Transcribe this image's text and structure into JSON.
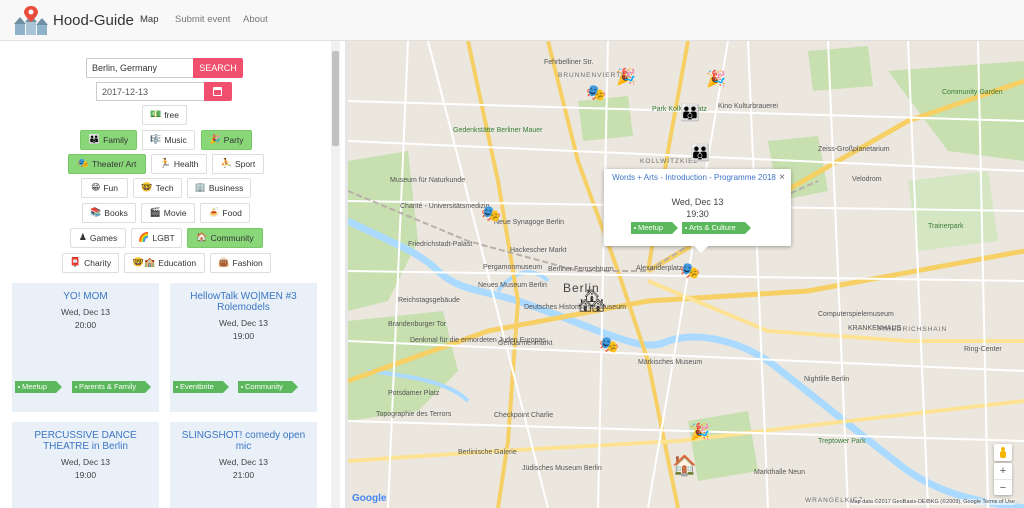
{
  "brand": {
    "title": "Hood-Guide"
  },
  "nav": {
    "map": "Map",
    "submit": "Submit event",
    "about": "About"
  },
  "search": {
    "location_value": "Berlin, Germany",
    "button": "SEARCH",
    "date_value": "2017-12-13"
  },
  "filters": {
    "free": {
      "emoji": "💵",
      "label": "free"
    },
    "family": {
      "emoji": "👪",
      "label": "Family"
    },
    "music": {
      "emoji": "🎼",
      "label": "Music"
    },
    "party": {
      "emoji": "🎉",
      "label": "Party"
    },
    "theater": {
      "emoji": "🎭",
      "label": "Theater/ Art"
    },
    "health": {
      "emoji": "🏃",
      "label": "Health"
    },
    "sport": {
      "emoji": "⛹",
      "label": "Sport"
    },
    "fun": {
      "emoji": "😁",
      "label": "Fun"
    },
    "tech": {
      "emoji": "🤓",
      "label": "Tech"
    },
    "business": {
      "emoji": "🏢",
      "label": "Business"
    },
    "books": {
      "emoji": "📚",
      "label": "Books"
    },
    "movie": {
      "emoji": "🎬",
      "label": "Movie"
    },
    "food": {
      "emoji": "🍝",
      "label": "Food"
    },
    "games": {
      "emoji": "♟",
      "label": "Games"
    },
    "lgbt": {
      "emoji": "🌈",
      "label": "LGBT"
    },
    "community": {
      "emoji": "🏠",
      "label": "Community"
    },
    "charity": {
      "emoji": "📮",
      "label": "Charity"
    },
    "education": {
      "emoji": "🤓🏫",
      "label": "Education"
    },
    "fashion": {
      "emoji": "👜",
      "label": "Fashion"
    }
  },
  "events": [
    {
      "title": "YO! MOM",
      "date": "Wed, Dec 13",
      "time": "20:00",
      "tags": [
        "Meetup",
        "Parents & Family"
      ]
    },
    {
      "title": "HellowTalk WO|MEN #3 Rolemodels",
      "date": "Wed, Dec 13",
      "time": "19:00",
      "tags": [
        "Eventbrite",
        "Community"
      ]
    },
    {
      "title": "PERCUSSIVE DANCE THEATRE in Berlin",
      "date": "Wed, Dec 13",
      "time": "19:00"
    },
    {
      "title": "SLINGSHOT! comedy open mic",
      "date": "Wed, Dec 13",
      "time": "21:00"
    }
  ],
  "popup": {
    "title": "Words + Arts - Introduction - Programme 2018",
    "close": "×",
    "date": "Wed, Dec 13",
    "time": "19:30",
    "tags": [
      "Meetup",
      "Arts & Culture"
    ]
  },
  "map": {
    "districts": [
      "BRUNNENVIERTEL",
      "KOLLWITZKIEZ",
      "WRANGELKIEZ",
      "FRIEDRICHSHAIN"
    ],
    "city_label": "Berlin",
    "streets": [
      "Fehrbelliner Str.",
      "Gedenkstätte Berliner Mauer",
      "Park Kollwitzplatz",
      "Kino Kulturbrauerei",
      "Museum für Naturkunde",
      "Charité - Universitätsmedizin",
      "Neue Synagoge Berlin",
      "Hackescher Markt",
      "Friedrichstadt-Palast",
      "Pergamonmuseum",
      "Berliner Fernsehturm",
      "Alexanderplatz",
      "Reichstagsgebäude",
      "Neues Museum Berlin",
      "Brandenburger Tor",
      "Deutsches Historisches Museum",
      "Denkmal für die ermordeten Juden Europas",
      "Gendarmenmarkt",
      "Märkisches Museum",
      "Potsdamer Platz",
      "Topographie des Terrors",
      "Checkpoint Charlie",
      "Berlinische Galerie",
      "Jüdisches Museum Berlin",
      "Markthalle Neun",
      "Computerspielemuseum",
      "KRANKENHAUS",
      "Ring-Center",
      "Nightlife Berlin",
      "Velodrom",
      "Community Garden",
      "Trainerpark",
      "Zeiss-Großplanetarium",
      "Treptower Park"
    ],
    "logo": "Google",
    "attribution": "Map data ©2017 GeoBasis-DE/BKG (©2009), Google   Terms of Use",
    "zoom_in": "+",
    "zoom_out": "−"
  },
  "colors": {
    "accent": "#f0506e",
    "tag": "#5cb85c",
    "active_chip": "#8ad77a",
    "card_bg": "#e9f0f8",
    "link": "#3b76c4"
  }
}
